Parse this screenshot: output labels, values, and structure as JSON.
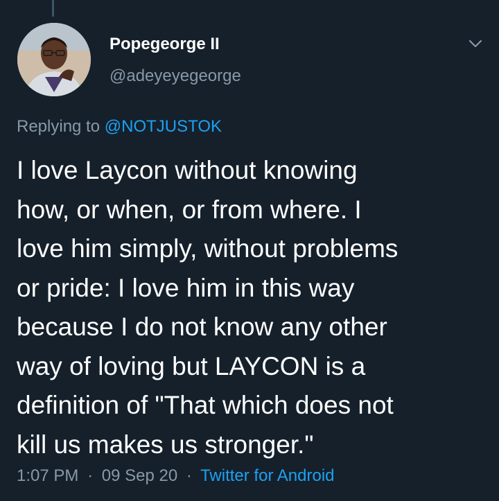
{
  "tweet": {
    "author": {
      "display_name": "Popegeorge II",
      "handle": "@adeyeyegeorge"
    },
    "replying_prefix": "Replying to ",
    "replying_to": "@NOTJUSTOK",
    "text": "I love Laycon without knowing\nhow, or when, or from where. I\nlove him simply, without problems\nor pride: I love him in this way\nbecause I do not know any other\nway of loving but LAYCON is a\ndefinition of \"That which does not\nkill us makes us stronger.\"",
    "time": "1:07 PM",
    "separator": "·",
    "date": "09 Sep 20",
    "source": "Twitter for Android"
  },
  "icons": {
    "menu": "chevron-down-icon",
    "avatar": "profile-photo"
  },
  "colors": {
    "background": "#15202b",
    "primary_text": "#ffffff",
    "secondary_text": "#8899a6",
    "link": "#1da1f2",
    "thread_line": "#3d5466"
  }
}
